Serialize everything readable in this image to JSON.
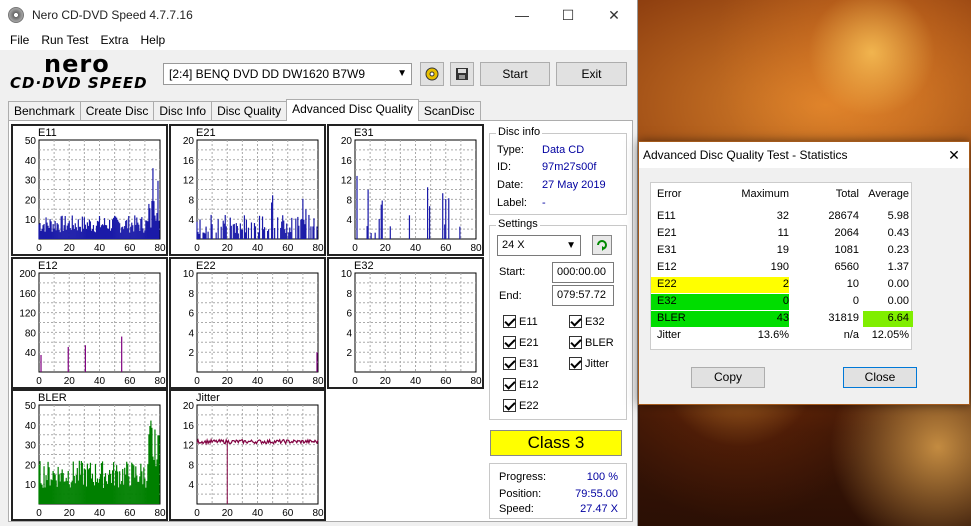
{
  "window": {
    "title": "Nero CD-DVD Speed 4.7.7.16",
    "minimize": "—",
    "maximize": "☐",
    "close": "✕"
  },
  "menu": [
    "File",
    "Run Test",
    "Extra",
    "Help"
  ],
  "logo": {
    "line1": "nero",
    "line2": "CD·DVD SPEED"
  },
  "toolbar": {
    "drive": "[2:4]   BENQ DVD DD DW1620 B7W9",
    "start": "Start",
    "exit": "Exit"
  },
  "tabs": [
    "Benchmark",
    "Create Disc",
    "Disc Info",
    "Disc Quality",
    "Advanced Disc Quality",
    "ScanDisc"
  ],
  "active_tab": 4,
  "graphs": {
    "x_ticks": [
      "0",
      "20",
      "40",
      "60",
      "80"
    ],
    "e11": {
      "name": "E11",
      "y_ticks": [
        "50",
        "40",
        "30",
        "20",
        "10"
      ],
      "ymax": 50,
      "color": "#1a1aa8"
    },
    "e21": {
      "name": "E21",
      "y_ticks": [
        "20",
        "16",
        "12",
        "8",
        "4"
      ],
      "ymax": 20,
      "color": "#1a1aa8"
    },
    "e31": {
      "name": "E31",
      "y_ticks": [
        "20",
        "16",
        "12",
        "8",
        "4"
      ],
      "ymax": 20,
      "color": "#1a1aa8"
    },
    "e12": {
      "name": "E12",
      "y_ticks": [
        "200",
        "160",
        "120",
        "80",
        "40"
      ],
      "ymax": 200,
      "color": "#800080"
    },
    "e22": {
      "name": "E22",
      "y_ticks": [
        "10",
        "8",
        "6",
        "4",
        "2"
      ],
      "ymax": 10,
      "color": "#800080"
    },
    "e32": {
      "name": "E32",
      "y_ticks": [
        "10",
        "8",
        "6",
        "4",
        "2"
      ],
      "ymax": 10,
      "color": "#800080"
    },
    "bler": {
      "name": "BLER",
      "y_ticks": [
        "50",
        "40",
        "30",
        "20",
        "10"
      ],
      "ymax": 50,
      "color": "#008000"
    },
    "jitter": {
      "name": "Jitter",
      "y_ticks": [
        "20",
        "16",
        "12",
        "8",
        "4"
      ],
      "ymax": 20,
      "color": "#800040"
    }
  },
  "disc_info": {
    "title": "Disc info",
    "type_label": "Type:",
    "type": "Data CD",
    "id_label": "ID:",
    "id": "97m27s00f",
    "date_label": "Date:",
    "date": "27 May 2019",
    "label_label": "Label:",
    "label": "-"
  },
  "settings": {
    "title": "Settings",
    "speed": "24 X",
    "start_label": "Start:",
    "start": "000:00.00",
    "end_label": "End:",
    "end": "079:57.72",
    "checks": [
      "E11",
      "E32",
      "E21",
      "BLER",
      "E31",
      "Jitter",
      "E12",
      "E22"
    ]
  },
  "class": "Class 3",
  "progress": {
    "progress_label": "Progress:",
    "progress": "100 %",
    "position_label": "Position:",
    "position": "79:55.00",
    "speed_label": "Speed:",
    "speed": "27.47 X"
  },
  "stats_dialog": {
    "title": "Advanced Disc Quality Test - Statistics",
    "close": "✕",
    "headers": [
      "Error",
      "Maximum",
      "Total",
      "Average"
    ],
    "rows": [
      [
        "E11",
        "32",
        "28674",
        "5.98"
      ],
      [
        "E21",
        "11",
        "2064",
        "0.43"
      ],
      [
        "E31",
        "19",
        "1081",
        "0.23"
      ],
      [
        "E12",
        "190",
        "6560",
        "1.37"
      ],
      [
        "E22",
        "2",
        "10",
        "0.00"
      ],
      [
        "E32",
        "0",
        "0",
        "0.00"
      ],
      [
        "BLER",
        "43",
        "31819",
        "6.64"
      ],
      [
        "Jitter",
        "13.6%",
        "n/a",
        "12.05%"
      ]
    ],
    "copy": "Copy",
    "close_button": "Close"
  }
}
